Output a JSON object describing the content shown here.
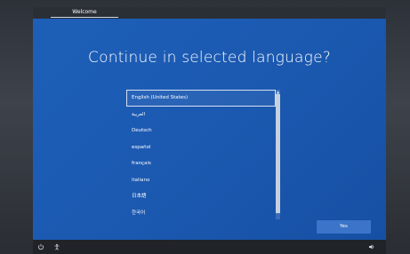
{
  "tabs": [
    {
      "label": "Welcome"
    }
  ],
  "title": "Continue in selected language?",
  "languages": [
    {
      "label": "English (United States)"
    },
    {
      "label": "العربية"
    },
    {
      "label": "Deutsch"
    },
    {
      "label": "español"
    },
    {
      "label": "français"
    },
    {
      "label": "italiano"
    },
    {
      "label": "日本語"
    },
    {
      "label": "한국어"
    }
  ],
  "selected_language": "English (United States)",
  "yes_label": "Yes",
  "icons": {
    "power": "power-icon",
    "accessibility": "accessibility-icon",
    "volume": "volume-icon",
    "scroll_up": "chevron-up-icon"
  },
  "colors": {
    "background": "#1c5ab2",
    "button": "#3b74c8",
    "text": "#ffffff"
  }
}
